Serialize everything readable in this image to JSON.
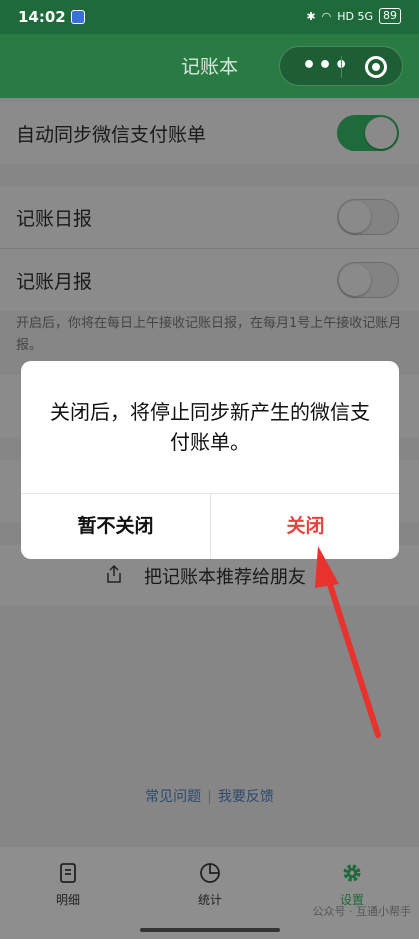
{
  "status_bar": {
    "time": "14:02",
    "network": "HD 5G",
    "battery": "89"
  },
  "navbar": {
    "title": "记账本"
  },
  "settings": {
    "auto_sync_label": "自动同步微信支付账单",
    "daily_label": "记账日报",
    "monthly_label": "记账月报",
    "hint": "开启后，你将在每日上午接收记账日报，在每月1号上午接收记账月报。",
    "share_label": "把记账本推荐给朋友"
  },
  "footer_links": {
    "faq": "常见问题",
    "separator": "|",
    "feedback": "我要反馈"
  },
  "tabbar": {
    "items": [
      {
        "label": "明细"
      },
      {
        "label": "统计"
      },
      {
        "label": "设置"
      }
    ]
  },
  "dialog": {
    "message": "关闭后，将停止同步新产生的微信支付账单。",
    "cancel_label": "暂不关闭",
    "confirm_label": "关闭"
  },
  "watermark": "公众号 · 互通小帮手",
  "colors": {
    "brand_green": "#2a7a44",
    "danger_red": "#e64340",
    "annotation_arrow": "#e8322e"
  }
}
